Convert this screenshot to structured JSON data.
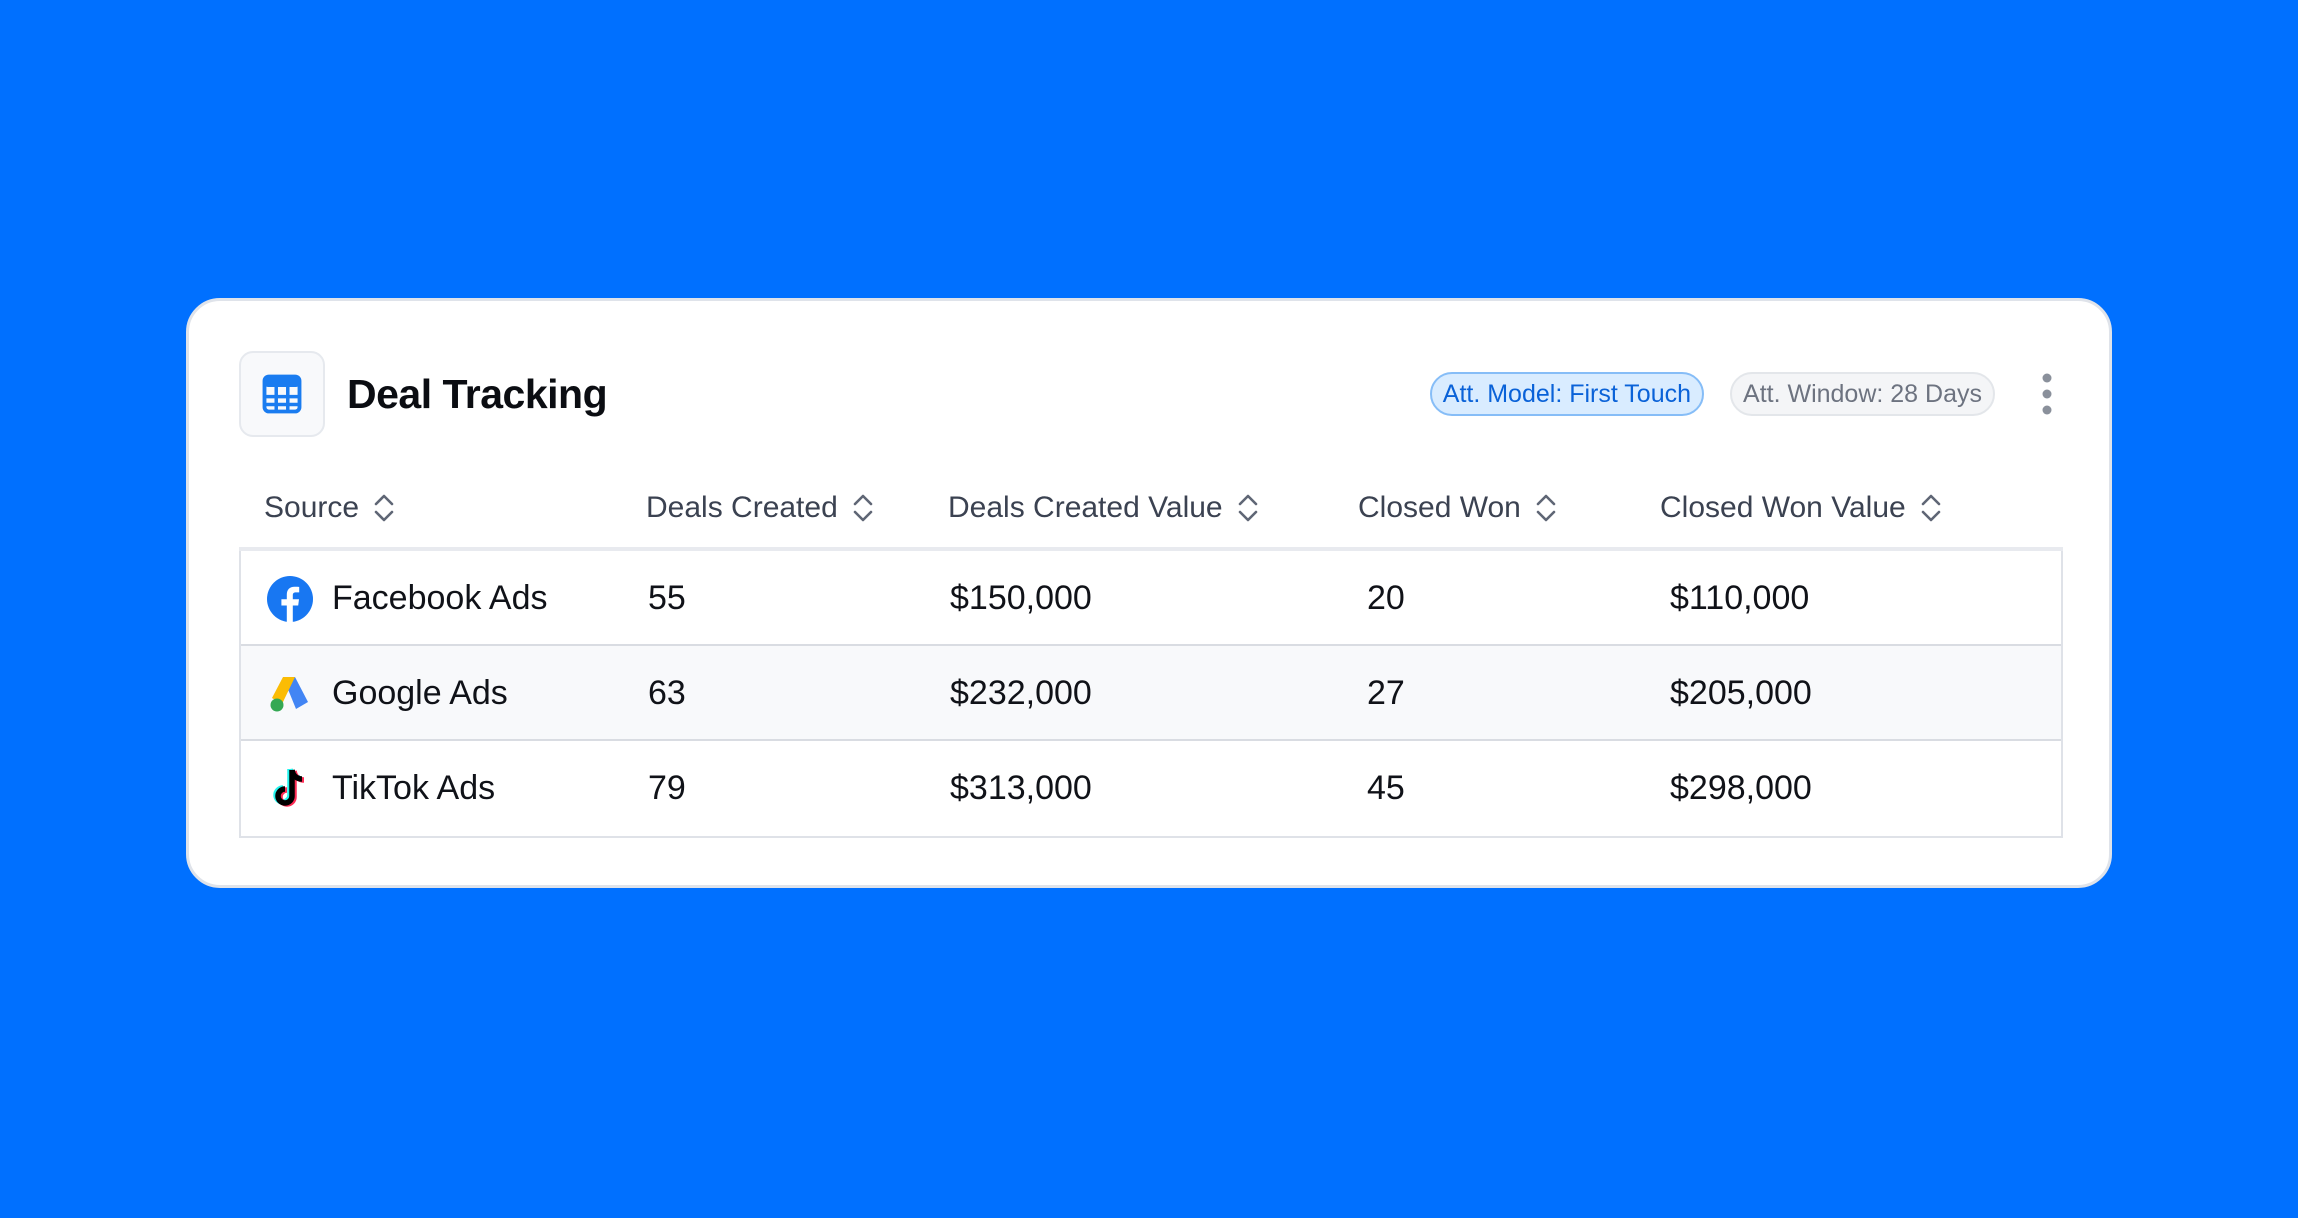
{
  "widget": {
    "title": "Deal Tracking",
    "icon": "calculator-icon",
    "badges": {
      "model": "Att. Model: First Touch",
      "window": "Att. Window: 28 Days"
    },
    "menu_icon": "more-vertical-icon"
  },
  "table": {
    "columns": [
      "Source",
      "Deals Created",
      "Deals Created Value",
      "Closed Won",
      "Closed Won Value"
    ],
    "sort_icon": "sort-chevrons-icon",
    "rows": [
      {
        "source": "Facebook Ads",
        "icon": "facebook-icon",
        "deals_created": "55",
        "deals_created_value": "$150,000",
        "closed_won": "20",
        "closed_won_value": "$110,000"
      },
      {
        "source": "Google Ads",
        "icon": "google-ads-icon",
        "deals_created": "63",
        "deals_created_value": "$232,000",
        "closed_won": "27",
        "closed_won_value": "$205,000"
      },
      {
        "source": "TikTok Ads",
        "icon": "tiktok-icon",
        "deals_created": "79",
        "deals_created_value": "$313,000",
        "closed_won": "45",
        "closed_won_value": "$298,000"
      }
    ]
  },
  "colors": {
    "background": "#0070FF",
    "accent": "#0A62D8",
    "facebook": "#1877F2"
  }
}
